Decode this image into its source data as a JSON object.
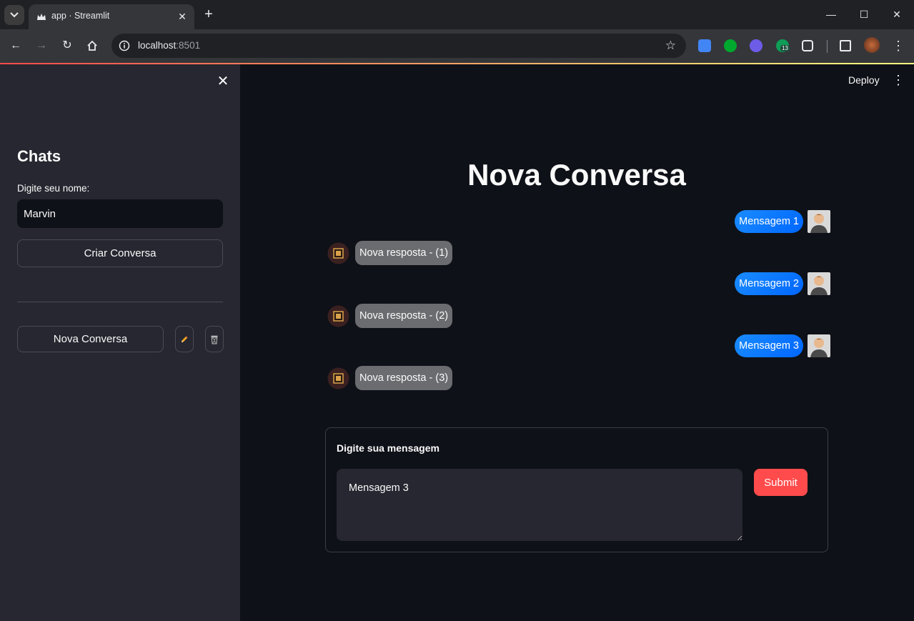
{
  "browser": {
    "tab_title": "app · Streamlit",
    "url_host": "localhost",
    "url_port": ":8501",
    "extension_badge": "13"
  },
  "sidebar": {
    "title": "Chats",
    "name_label": "Digite seu nome:",
    "name_value": "Marvin",
    "create_button": "Criar Conversa",
    "conversations": [
      {
        "label": "Nova Conversa"
      }
    ]
  },
  "header": {
    "deploy_label": "Deploy"
  },
  "main": {
    "title": "Nova Conversa",
    "messages": [
      {
        "role": "user",
        "text": "Mensagem 1"
      },
      {
        "role": "bot",
        "text": "Nova resposta - (1)"
      },
      {
        "role": "user",
        "text": "Mensagem 2"
      },
      {
        "role": "bot",
        "text": "Nova resposta - (2)"
      },
      {
        "role": "user",
        "text": "Mensagem 3"
      },
      {
        "role": "bot",
        "text": "Nova resposta - (3)"
      }
    ],
    "form": {
      "label": "Digite sua mensagem",
      "message_value": "Mensagem 3",
      "submit_label": "Submit"
    }
  },
  "colors": {
    "accent": "#ff4b4b",
    "user_bubble": "#1a8cff",
    "bot_bubble": "#6b6c70",
    "background": "#0e1117",
    "sidebar_bg": "#262730"
  },
  "icons": {
    "tab_favicon": "streamlit-crown-icon",
    "edit": "pencil-icon",
    "delete": "trash-icon",
    "close": "close-icon",
    "menu": "vertical-dots-icon"
  }
}
